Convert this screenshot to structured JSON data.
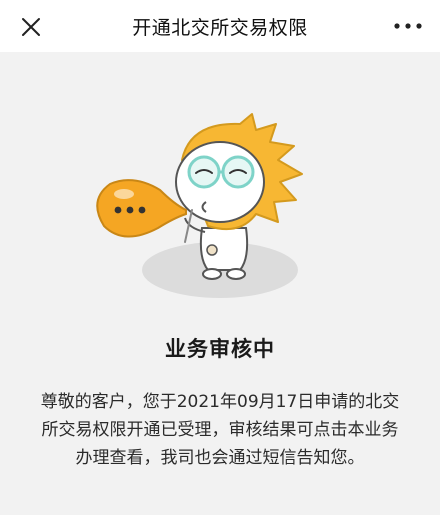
{
  "nav": {
    "title": "开通北交所交易权限",
    "close_icon": "close-icon",
    "more_icon": "more-icon"
  },
  "illustration": {
    "name": "mascot-blowing-bubble",
    "colors": {
      "hair": "#F7B733",
      "bubble": "#F5A623",
      "glasses": "#7ED3C8",
      "shadow": "#DCDCDC"
    }
  },
  "status": {
    "title": "业务审核中"
  },
  "message": {
    "text": "尊敬的客户，您于2021年09月17日申请的北交所交易权限开通已受理，审核结果可点击本业务办理查看，我司也会通过短信告知您。"
  }
}
